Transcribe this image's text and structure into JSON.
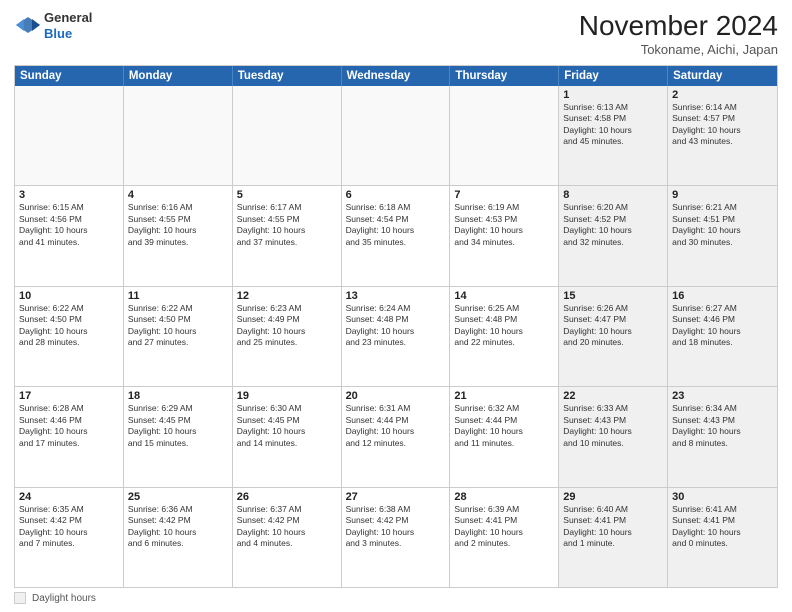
{
  "header": {
    "logo_general": "General",
    "logo_blue": "Blue",
    "title": "November 2024",
    "location": "Tokoname, Aichi, Japan"
  },
  "days_of_week": [
    "Sunday",
    "Monday",
    "Tuesday",
    "Wednesday",
    "Thursday",
    "Friday",
    "Saturday"
  ],
  "weeks": [
    [
      {
        "day": "",
        "text": "",
        "empty": true
      },
      {
        "day": "",
        "text": "",
        "empty": true
      },
      {
        "day": "",
        "text": "",
        "empty": true
      },
      {
        "day": "",
        "text": "",
        "empty": true
      },
      {
        "day": "",
        "text": "",
        "empty": true
      },
      {
        "day": "1",
        "text": "Sunrise: 6:13 AM\nSunset: 4:58 PM\nDaylight: 10 hours\nand 45 minutes.",
        "shaded": true
      },
      {
        "day": "2",
        "text": "Sunrise: 6:14 AM\nSunset: 4:57 PM\nDaylight: 10 hours\nand 43 minutes.",
        "shaded": true
      }
    ],
    [
      {
        "day": "3",
        "text": "Sunrise: 6:15 AM\nSunset: 4:56 PM\nDaylight: 10 hours\nand 41 minutes."
      },
      {
        "day": "4",
        "text": "Sunrise: 6:16 AM\nSunset: 4:55 PM\nDaylight: 10 hours\nand 39 minutes."
      },
      {
        "day": "5",
        "text": "Sunrise: 6:17 AM\nSunset: 4:55 PM\nDaylight: 10 hours\nand 37 minutes."
      },
      {
        "day": "6",
        "text": "Sunrise: 6:18 AM\nSunset: 4:54 PM\nDaylight: 10 hours\nand 35 minutes."
      },
      {
        "day": "7",
        "text": "Sunrise: 6:19 AM\nSunset: 4:53 PM\nDaylight: 10 hours\nand 34 minutes."
      },
      {
        "day": "8",
        "text": "Sunrise: 6:20 AM\nSunset: 4:52 PM\nDaylight: 10 hours\nand 32 minutes.",
        "shaded": true
      },
      {
        "day": "9",
        "text": "Sunrise: 6:21 AM\nSunset: 4:51 PM\nDaylight: 10 hours\nand 30 minutes.",
        "shaded": true
      }
    ],
    [
      {
        "day": "10",
        "text": "Sunrise: 6:22 AM\nSunset: 4:50 PM\nDaylight: 10 hours\nand 28 minutes."
      },
      {
        "day": "11",
        "text": "Sunrise: 6:22 AM\nSunset: 4:50 PM\nDaylight: 10 hours\nand 27 minutes."
      },
      {
        "day": "12",
        "text": "Sunrise: 6:23 AM\nSunset: 4:49 PM\nDaylight: 10 hours\nand 25 minutes."
      },
      {
        "day": "13",
        "text": "Sunrise: 6:24 AM\nSunset: 4:48 PM\nDaylight: 10 hours\nand 23 minutes."
      },
      {
        "day": "14",
        "text": "Sunrise: 6:25 AM\nSunset: 4:48 PM\nDaylight: 10 hours\nand 22 minutes."
      },
      {
        "day": "15",
        "text": "Sunrise: 6:26 AM\nSunset: 4:47 PM\nDaylight: 10 hours\nand 20 minutes.",
        "shaded": true
      },
      {
        "day": "16",
        "text": "Sunrise: 6:27 AM\nSunset: 4:46 PM\nDaylight: 10 hours\nand 18 minutes.",
        "shaded": true
      }
    ],
    [
      {
        "day": "17",
        "text": "Sunrise: 6:28 AM\nSunset: 4:46 PM\nDaylight: 10 hours\nand 17 minutes."
      },
      {
        "day": "18",
        "text": "Sunrise: 6:29 AM\nSunset: 4:45 PM\nDaylight: 10 hours\nand 15 minutes."
      },
      {
        "day": "19",
        "text": "Sunrise: 6:30 AM\nSunset: 4:45 PM\nDaylight: 10 hours\nand 14 minutes."
      },
      {
        "day": "20",
        "text": "Sunrise: 6:31 AM\nSunset: 4:44 PM\nDaylight: 10 hours\nand 12 minutes."
      },
      {
        "day": "21",
        "text": "Sunrise: 6:32 AM\nSunset: 4:44 PM\nDaylight: 10 hours\nand 11 minutes."
      },
      {
        "day": "22",
        "text": "Sunrise: 6:33 AM\nSunset: 4:43 PM\nDaylight: 10 hours\nand 10 minutes.",
        "shaded": true
      },
      {
        "day": "23",
        "text": "Sunrise: 6:34 AM\nSunset: 4:43 PM\nDaylight: 10 hours\nand 8 minutes.",
        "shaded": true
      }
    ],
    [
      {
        "day": "24",
        "text": "Sunrise: 6:35 AM\nSunset: 4:42 PM\nDaylight: 10 hours\nand 7 minutes."
      },
      {
        "day": "25",
        "text": "Sunrise: 6:36 AM\nSunset: 4:42 PM\nDaylight: 10 hours\nand 6 minutes."
      },
      {
        "day": "26",
        "text": "Sunrise: 6:37 AM\nSunset: 4:42 PM\nDaylight: 10 hours\nand 4 minutes."
      },
      {
        "day": "27",
        "text": "Sunrise: 6:38 AM\nSunset: 4:42 PM\nDaylight: 10 hours\nand 3 minutes."
      },
      {
        "day": "28",
        "text": "Sunrise: 6:39 AM\nSunset: 4:41 PM\nDaylight: 10 hours\nand 2 minutes."
      },
      {
        "day": "29",
        "text": "Sunrise: 6:40 AM\nSunset: 4:41 PM\nDaylight: 10 hours\nand 1 minute.",
        "shaded": true
      },
      {
        "day": "30",
        "text": "Sunrise: 6:41 AM\nSunset: 4:41 PM\nDaylight: 10 hours\nand 0 minutes.",
        "shaded": true
      }
    ]
  ],
  "footer": {
    "legend_label": "Daylight hours"
  }
}
